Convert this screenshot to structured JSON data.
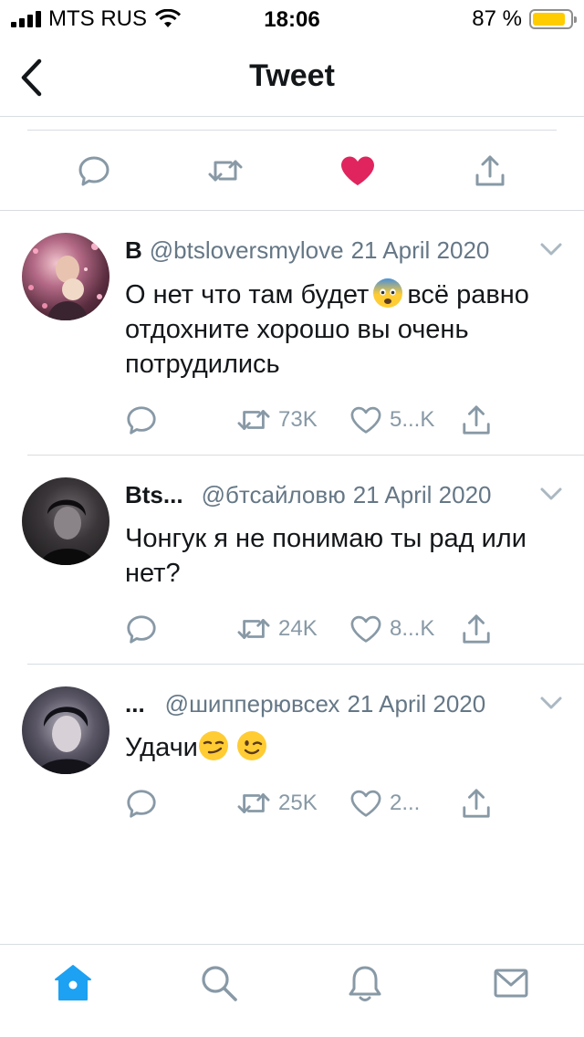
{
  "status_bar": {
    "carrier": "MTS RUS",
    "time": "18:06",
    "battery_percent": "87 %",
    "battery_level": 0.87
  },
  "nav": {
    "title": "Tweet"
  },
  "colors": {
    "like_active": "#e0245e",
    "icon_gray": "#8899a6",
    "text_secondary": "#657786",
    "accent": "#1da1f2",
    "battery": "#ffcc00"
  },
  "replies": [
    {
      "name": "B",
      "handle": "@btsloversmylove",
      "date": "21 April 2020",
      "text_parts": [
        "О нет что там будет",
        "всё равно отдохните хорошо вы очень потрудились"
      ],
      "emoji": [
        "fearful-face"
      ],
      "retweets": "73K",
      "likes": "5...K"
    },
    {
      "name": "Bts...",
      "handle": "@бтсайловю",
      "date": "21 April 2020",
      "text": "Чонгук я не понимаю ты рад или нет?",
      "retweets": "24K",
      "likes": "8...K"
    },
    {
      "name": "...",
      "handle": "@шипперювсех",
      "date": "21 April 2020",
      "text": "Удачи",
      "emoji": [
        "smirking-face",
        "winking-face"
      ],
      "retweets": "25K",
      "likes": "2..."
    }
  ],
  "tabs": [
    "home-icon",
    "search-icon",
    "notifications-icon",
    "messages-icon"
  ]
}
